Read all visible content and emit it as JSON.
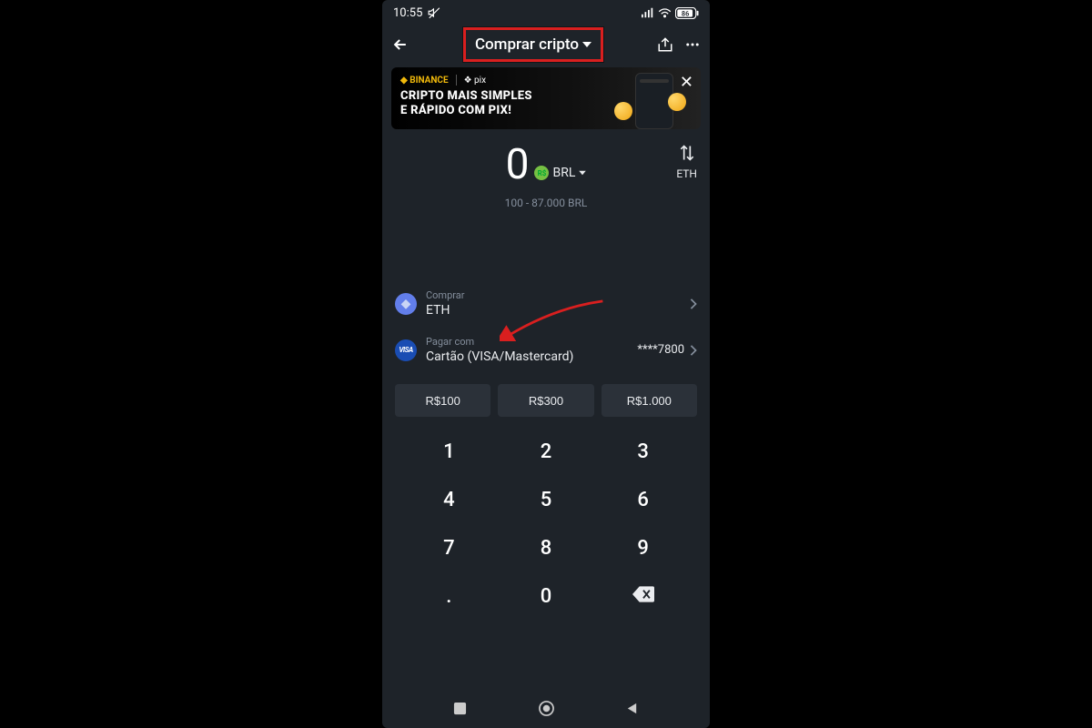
{
  "status": {
    "time": "10:55",
    "battery": "86"
  },
  "nav": {
    "title": "Comprar cripto"
  },
  "banner": {
    "brand1": "BINANCE",
    "brand2": "pix",
    "line1": "CRIPTO MAIS SIMPLES",
    "line2": "E RÁPIDO COM PIX!"
  },
  "amount": {
    "value": "0",
    "currency": "BRL",
    "target": "ETH",
    "range": "100 - 87.000 BRL"
  },
  "buy_row": {
    "label": "Comprar",
    "value": "ETH"
  },
  "pay_row": {
    "label": "Pagar com",
    "value": "Cartão (VISA/Mastercard)",
    "tail": "****7800"
  },
  "quick": [
    "R$100",
    "R$300",
    "R$1.000"
  ],
  "keypad": [
    "1",
    "2",
    "3",
    "4",
    "5",
    "6",
    "7",
    "8",
    "9",
    ".",
    "0",
    "⌫"
  ],
  "visa_text": "VISA",
  "brl_badge": "R$"
}
